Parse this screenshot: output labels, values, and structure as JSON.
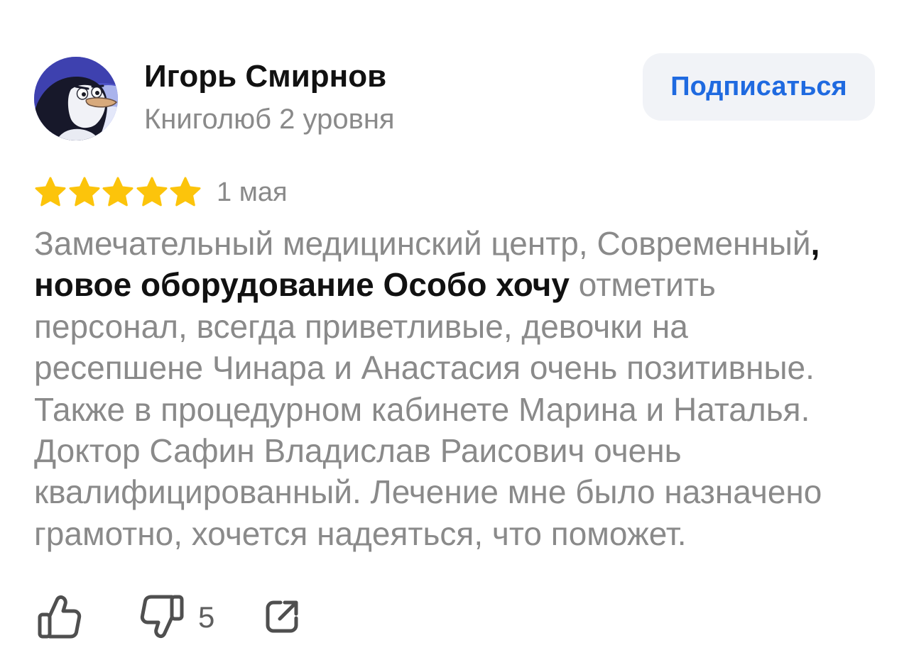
{
  "author": {
    "name": "Игорь Смирнов",
    "status": "Книголюб 2 уровня",
    "subscribe_label": "Подписаться"
  },
  "review": {
    "rating": 5,
    "rating_max": 5,
    "date": "1 мая",
    "lines": [
      [
        {
          "text": "Замечательный медицинский центр, Современный",
          "highlight": false
        },
        {
          "text": ",",
          "highlight": true
        }
      ],
      [
        {
          "text": "новое оборудование Особо хочу",
          "highlight": true
        },
        {
          "text": " отметить",
          "highlight": false
        }
      ],
      [
        {
          "text": "персонал, всегда приветливые, девочки на",
          "highlight": false
        }
      ],
      [
        {
          "text": "ресепшене Чинара и Анастасия очень позитивные.",
          "highlight": false
        }
      ],
      [
        {
          "text": "Также в процедурном кабинете Марина и Наталья.",
          "highlight": false
        }
      ],
      [
        {
          "text": "Доктор Сафин Владислав Раисович очень",
          "highlight": false
        }
      ],
      [
        {
          "text": "квалифицированный. Лечение мне было назначено",
          "highlight": false
        }
      ],
      [
        {
          "text": "грамотно, хочется надеяться, что поможет.",
          "highlight": false
        }
      ]
    ]
  },
  "actions": {
    "like_icon": "thumbs-up-icon",
    "dislike_icon": "thumbs-down-icon",
    "dislike_count": "5",
    "share_icon": "share-icon"
  },
  "colors": {
    "accent": "#1f6ae0",
    "button_bg": "#f1f3f7",
    "star": "#fcc40b",
    "text_primary": "#111111",
    "text_muted": "#8a8a8a",
    "icon": "#4f4f4f"
  }
}
